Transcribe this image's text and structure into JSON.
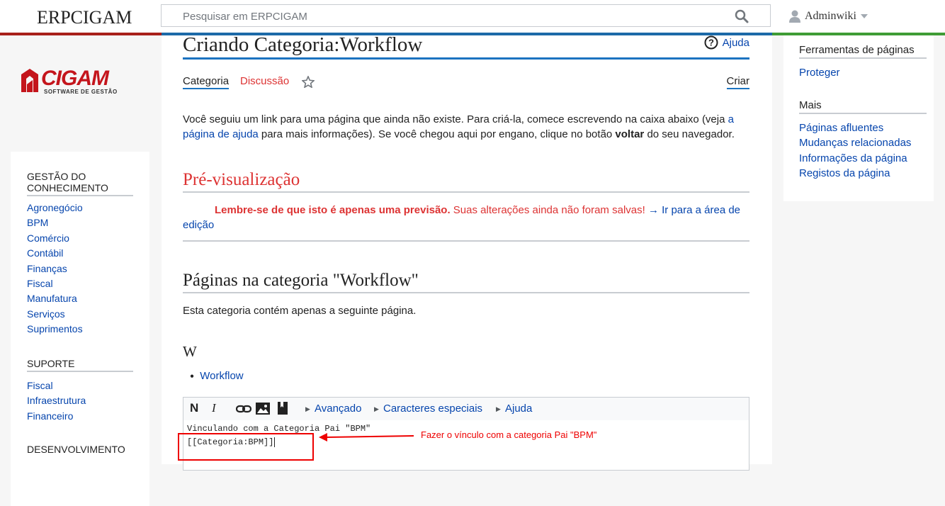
{
  "app": {
    "brand": "ERPCIGAM"
  },
  "search": {
    "placeholder": "Pesquisar em ERPCIGAM"
  },
  "user": {
    "name": "Adminwiki"
  },
  "colors": {
    "red": "#a8201a",
    "blue": "#1c73c0",
    "green": "#3f9c35",
    "link": "#0645ad",
    "danger": "#d33"
  },
  "logo": {
    "text": "CIGAM",
    "subtitle": "SOFTWARE DE GESTÃO"
  },
  "sidebar": {
    "sections": [
      {
        "title": "GESTÃO DO CONHECIMENTO",
        "items": [
          "Agronegócio",
          "BPM",
          "Comércio",
          "Contábil",
          "Finanças",
          "Fiscal",
          "Manufatura",
          "Serviços",
          "Suprimentos"
        ]
      },
      {
        "title": "SUPORTE",
        "items": [
          "Fiscal",
          "Infraestrutura",
          "Financeiro"
        ]
      },
      {
        "title": "DESENVOLVIMENTO",
        "items": []
      }
    ]
  },
  "page": {
    "title": "Criando Categoria:Workflow",
    "help": "Ajuda",
    "tabs": {
      "category": "Categoria",
      "discussion": "Discussão",
      "create": "Criar"
    },
    "intro": {
      "part1": "Você seguiu um link para uma página que ainda não existe. Para criá-la, comece escrevendo na caixa abaixo (veja ",
      "link": "a página de ajuda",
      "part2": " para mais informações). Se você chegou aqui por engano, clique no botão ",
      "bold": "voltar",
      "part3": " do seu navegador."
    },
    "preview": {
      "heading": "Pré-visualização",
      "bold": "Lembre-se de que isto é apenas uma previsão.",
      "text": " Suas alterações ainda não foram salvas!",
      "link": "→ Ir para a área de edição"
    },
    "category": {
      "heading": "Páginas na categoria \"Workflow\"",
      "text": "Esta categoria contém apenas a seguinte página.",
      "letter": "W",
      "pages": [
        "Workflow"
      ]
    },
    "toolbar": {
      "bold": "N",
      "italic": "I",
      "advanced": "Avançado",
      "special": "Caracteres especiais",
      "help": "Ajuda"
    },
    "editor": {
      "line1": "Vinculando com a Categoria Pai \"BPM\"",
      "line2": "[[Categoria:BPM]]"
    },
    "annotation": "Fazer o vínculo com a categoria Pai \"BPM\""
  },
  "tools": {
    "heading1": "Ferramentas de páginas",
    "items1": [
      "Proteger"
    ],
    "heading2": "Mais",
    "items2": [
      "Páginas afluentes",
      "Mudanças relacionadas",
      "Informações da página",
      "Registos da página"
    ]
  }
}
